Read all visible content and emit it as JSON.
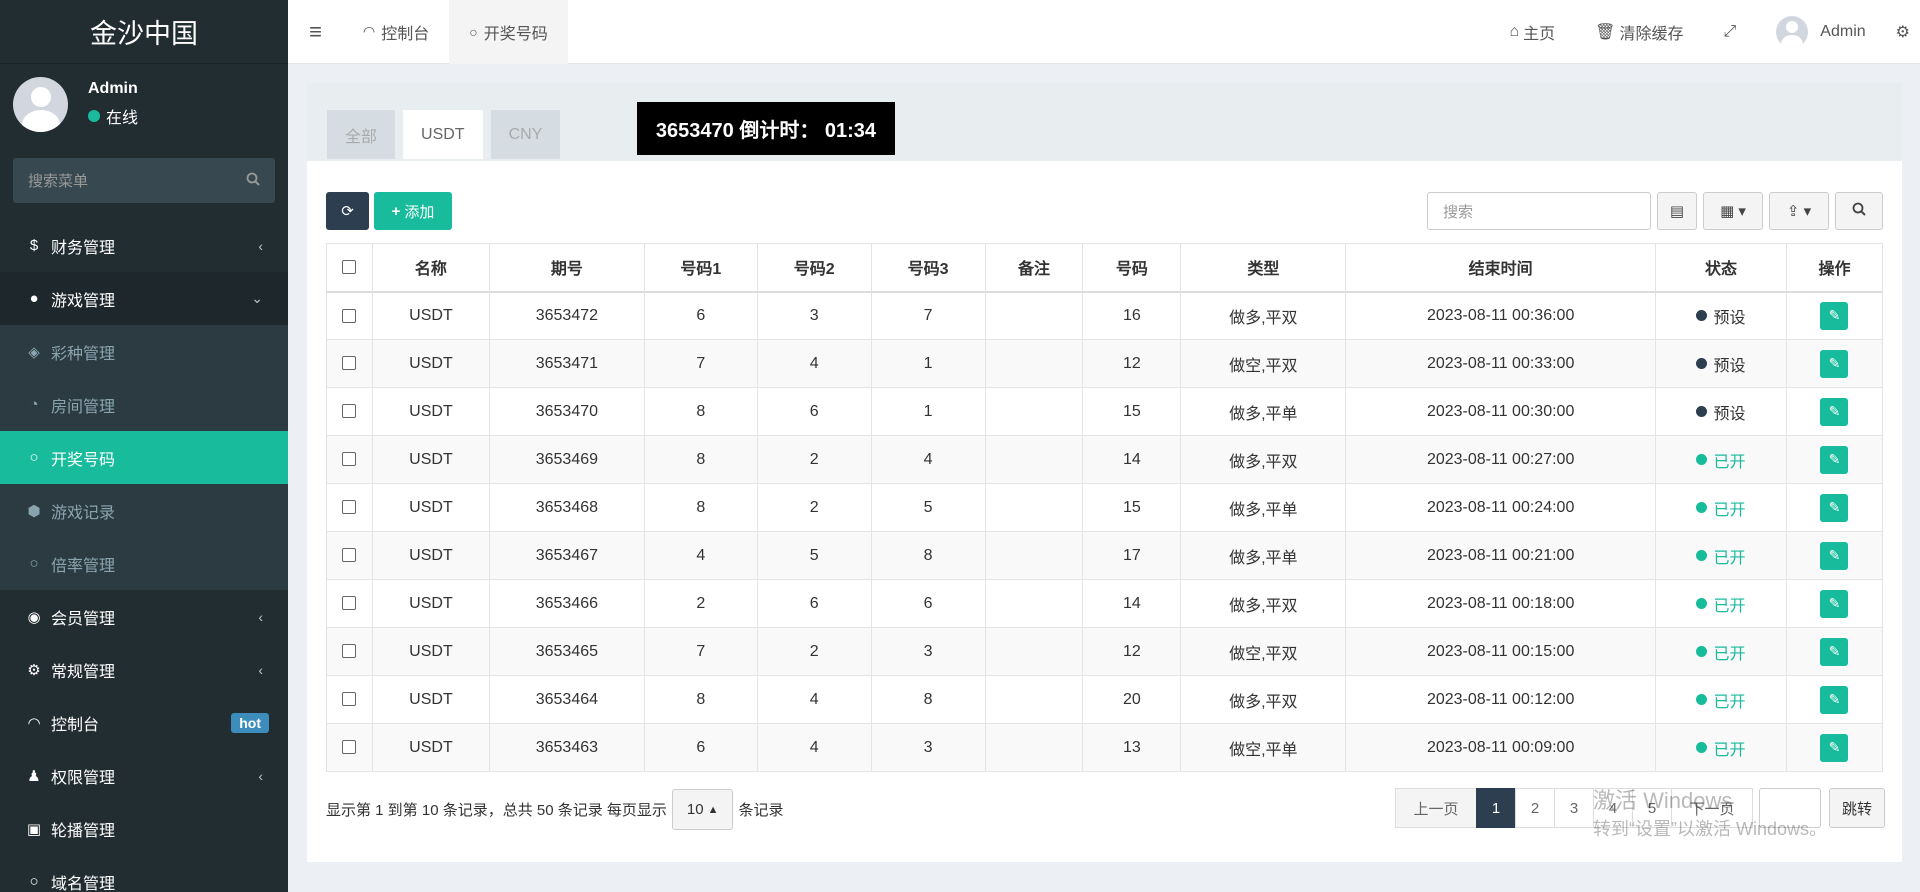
{
  "sidebar": {
    "logo": "金沙中国",
    "user": {
      "name": "Admin",
      "status": "在线",
      "status_color": "#18bc9c"
    },
    "search_placeholder": "搜索菜单",
    "menu": [
      {
        "label": "财务管理",
        "icon": "dollar-icon",
        "arrow": "‹"
      },
      {
        "label": "游戏管理",
        "icon": "bomb-icon",
        "arrow": "⌄"
      },
      {
        "label": "会员管理",
        "icon": "user-circle-icon",
        "arrow": "‹"
      },
      {
        "label": "常规管理",
        "icon": "cogs-icon",
        "arrow": "‹"
      },
      {
        "label": "控制台",
        "icon": "dashboard-icon",
        "badge": "hot"
      },
      {
        "label": "权限管理",
        "icon": "group-icon",
        "arrow": "‹"
      },
      {
        "label": "轮播管理",
        "icon": "image-icon"
      },
      {
        "label": "域名管理",
        "icon": "circle-icon"
      }
    ],
    "submenu": [
      {
        "label": "彩种管理",
        "icon": "gamepad-icon"
      },
      {
        "label": "房间管理",
        "icon": "pie-icon"
      },
      {
        "label": "开奖号码",
        "icon": "circle-icon"
      },
      {
        "label": "游戏记录",
        "icon": "cube-icon"
      },
      {
        "label": "倍率管理",
        "icon": "circle-icon"
      }
    ]
  },
  "topbar": {
    "tabs": [
      {
        "label": "控制台"
      },
      {
        "label": "开奖号码"
      }
    ],
    "home": "主页",
    "clear_cache": "清除缓存",
    "admin": "Admin"
  },
  "panel": {
    "tabs": [
      "全部",
      "USDT",
      "CNY"
    ],
    "countdown": "3653470 倒计时： 01:34",
    "add_label": "添加",
    "search_placeholder": "搜索"
  },
  "table": {
    "headers": [
      "名称",
      "期号",
      "号码1",
      "号码2",
      "号码3",
      "备注",
      "号码",
      "类型",
      "结束时间",
      "状态",
      "操作"
    ],
    "rows": [
      {
        "name": "USDT",
        "issue": "3653472",
        "n1": "6",
        "n2": "3",
        "n3": "7",
        "note": "",
        "sum": "16",
        "type": "做多,平双",
        "end": "2023-08-11 00:36:00",
        "status": "预设"
      },
      {
        "name": "USDT",
        "issue": "3653471",
        "n1": "7",
        "n2": "4",
        "n3": "1",
        "note": "",
        "sum": "12",
        "type": "做空,平双",
        "end": "2023-08-11 00:33:00",
        "status": "预设"
      },
      {
        "name": "USDT",
        "issue": "3653470",
        "n1": "8",
        "n2": "6",
        "n3": "1",
        "note": "",
        "sum": "15",
        "type": "做多,平单",
        "end": "2023-08-11 00:30:00",
        "status": "预设"
      },
      {
        "name": "USDT",
        "issue": "3653469",
        "n1": "8",
        "n2": "2",
        "n3": "4",
        "note": "",
        "sum": "14",
        "type": "做多,平双",
        "end": "2023-08-11 00:27:00",
        "status": "已开"
      },
      {
        "name": "USDT",
        "issue": "3653468",
        "n1": "8",
        "n2": "2",
        "n3": "5",
        "note": "",
        "sum": "15",
        "type": "做多,平单",
        "end": "2023-08-11 00:24:00",
        "status": "已开"
      },
      {
        "name": "USDT",
        "issue": "3653467",
        "n1": "4",
        "n2": "5",
        "n3": "8",
        "note": "",
        "sum": "17",
        "type": "做多,平单",
        "end": "2023-08-11 00:21:00",
        "status": "已开"
      },
      {
        "name": "USDT",
        "issue": "3653466",
        "n1": "2",
        "n2": "6",
        "n3": "6",
        "note": "",
        "sum": "14",
        "type": "做多,平双",
        "end": "2023-08-11 00:18:00",
        "status": "已开"
      },
      {
        "name": "USDT",
        "issue": "3653465",
        "n1": "7",
        "n2": "2",
        "n3": "3",
        "note": "",
        "sum": "12",
        "type": "做空,平双",
        "end": "2023-08-11 00:15:00",
        "status": "已开"
      },
      {
        "name": "USDT",
        "issue": "3653464",
        "n1": "8",
        "n2": "4",
        "n3": "8",
        "note": "",
        "sum": "20",
        "type": "做多,平双",
        "end": "2023-08-11 00:12:00",
        "status": "已开"
      },
      {
        "name": "USDT",
        "issue": "3653463",
        "n1": "6",
        "n2": "4",
        "n3": "3",
        "note": "",
        "sum": "13",
        "type": "做空,平单",
        "end": "2023-08-11 00:09:00",
        "status": "已开"
      }
    ],
    "status_colors": {
      "预设": "#2c3e50",
      "已开": "#18bc9c"
    }
  },
  "footer": {
    "info_prefix": "显示第 1 到第 10 条记录，总共 50 条记录 每页显示",
    "page_size": "10",
    "info_suffix": "条记录",
    "prev": "上一页",
    "pages": [
      "1",
      "2",
      "3",
      "4",
      "5"
    ],
    "next": "下一页",
    "jump": "跳转"
  },
  "watermark": {
    "line1": "激活 Windows",
    "line2": "转到“设置”以激活 Windows。"
  }
}
